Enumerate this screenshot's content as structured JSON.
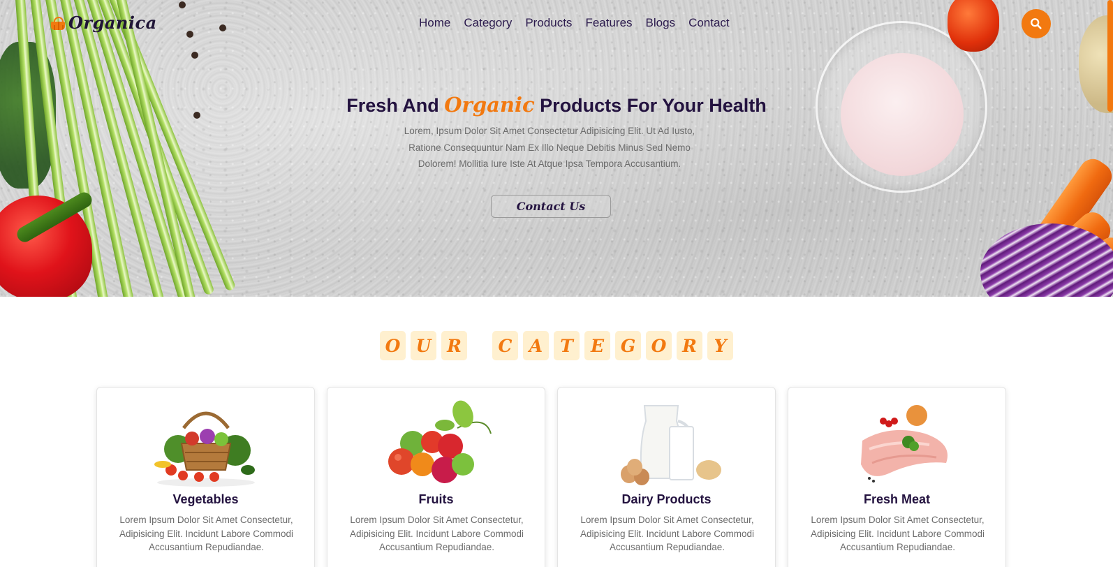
{
  "brand": {
    "name": "Organica",
    "accent_color": "#f27910",
    "dark_color": "#23123f"
  },
  "nav": {
    "items": [
      {
        "label": "Home"
      },
      {
        "label": "Category"
      },
      {
        "label": "Products"
      },
      {
        "label": "Features"
      },
      {
        "label": "Blogs"
      },
      {
        "label": "Contact"
      }
    ],
    "search_icon": "search-icon"
  },
  "hero": {
    "title_before": "Fresh And ",
    "title_accent": "Organic",
    "title_after": " Products For Your Health",
    "description": "Lorem, Ipsum Dolor Sit Amet Consectetur Adipisicing Elit. Ut Ad Iusto, Ratione Consequuntur Nam Ex Illo Neque Debitis Minus Sed Nemo Dolorem! Mollitia Iure Iste At Atque Ipsa Tempora Accusantium.",
    "cta_label": "Contact Us"
  },
  "category_section": {
    "heading_letters": [
      "O",
      "U",
      "R",
      " ",
      "C",
      "A",
      "T",
      "E",
      "G",
      "O",
      "R",
      "Y"
    ],
    "cards": [
      {
        "title": "Vegetables",
        "image_icon": "vegetable-basket-image",
        "description": "Lorem Ipsum Dolor Sit Amet Consectetur, Adipisicing Elit. Incidunt Labore Commodi Accusantium Repudiandae."
      },
      {
        "title": "Fruits",
        "image_icon": "fruits-image",
        "description": "Lorem Ipsum Dolor Sit Amet Consectetur, Adipisicing Elit. Incidunt Labore Commodi Accusantium Repudiandae."
      },
      {
        "title": "Dairy Products",
        "image_icon": "dairy-image",
        "description": "Lorem Ipsum Dolor Sit Amet Consectetur, Adipisicing Elit. Incidunt Labore Commodi Accusantium Repudiandae."
      },
      {
        "title": "Fresh Meat",
        "image_icon": "meat-image",
        "description": "Lorem Ipsum Dolor Sit Amet Consectetur, Adipisicing Elit. Incidunt Labore Commodi Accusantium Repudiandae."
      }
    ]
  }
}
